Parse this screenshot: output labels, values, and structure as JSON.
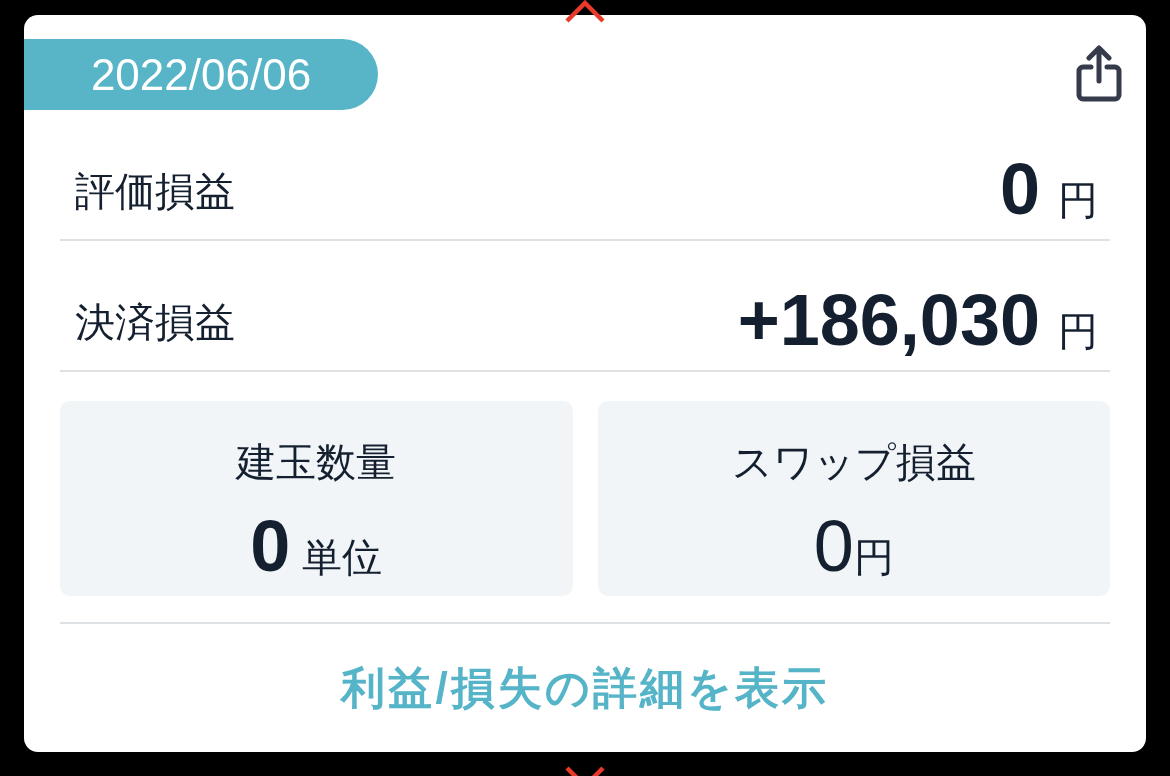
{
  "date_badge": "2022/06/06",
  "summary_rows": [
    {
      "label": "評価損益",
      "value": "0",
      "unit": "円"
    },
    {
      "label": "決済損益",
      "value": "+186,030",
      "unit": "円"
    }
  ],
  "stat_cards": [
    {
      "kind": "count",
      "label": "建玉数量",
      "value": "0",
      "unit": "単位"
    },
    {
      "kind": "amount",
      "label": "スワップ損益",
      "value": "0",
      "unit": "円"
    }
  ],
  "details_link": "利益/損失の詳細を表示"
}
